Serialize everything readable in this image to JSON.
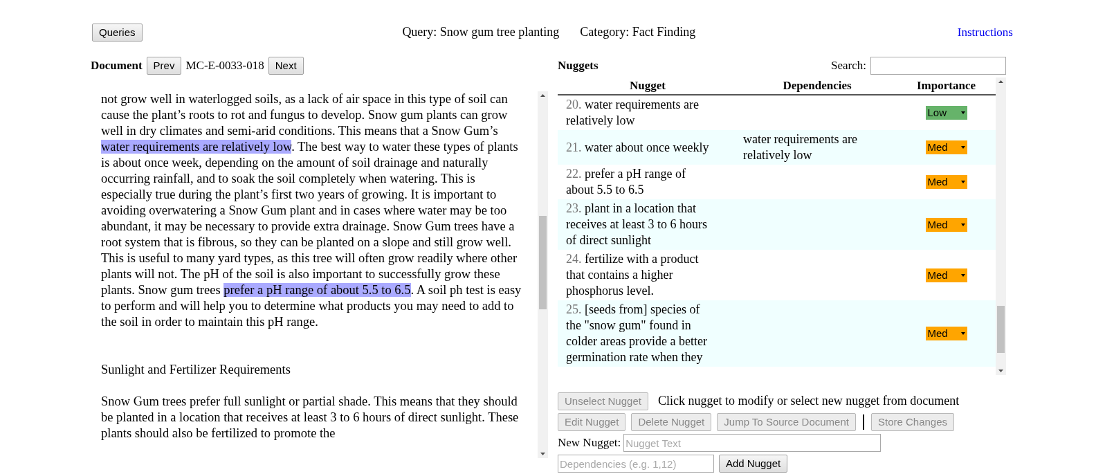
{
  "header": {
    "queries_button": {
      "label": "Queries",
      "disabled": false
    },
    "query": "Query: Snow gum tree planting",
    "category": "Category: Fact Finding",
    "instructions_link": "Instructions"
  },
  "document": {
    "label": "Document",
    "prev": {
      "label": "Prev",
      "disabled": false
    },
    "id": "MC-E-0033-018",
    "next": {
      "label": "Next",
      "disabled": false
    },
    "paragraphs": [
      {
        "kind": "text",
        "segments": [
          {
            "text": "not grow well in waterlogged soils, as a lack of air space in this type of soil can cause the plant’s roots to rot and fungus to develop. Snow gum plants can grow well in dry climates and semi-arid conditions. This means that a Snow Gum’s ",
            "highlighted": false
          },
          {
            "text": "water requirements are relatively low",
            "highlighted": true
          },
          {
            "text": ". The best way to water these types of plants is about once week, depending on the amount of soil drainage and naturally occurring rainfall, and to soak the soil completely when watering. This is especially true during the plant’s first two years of growing. It is important to avoiding overwatering a Snow Gum plant and in cases where water may be too abundant, it may be necessary to provide extra drainage. Snow Gum trees have a root system that is fibrous, so they can be planted on a slope and still grow well. This is useful to many yard types, as this tree will often grow readily where other plants will not. The pH of the soil is also important to successfully grow these plants. Snow gum trees ",
            "highlighted": false
          },
          {
            "text": "prefer a pH range of about 5.5 to 6.5",
            "highlighted": true
          },
          {
            "text": ". A soil ph test is easy to perform and will help you to determine what products you may need to add to the soil in order to maintain this pH range.",
            "highlighted": false
          }
        ]
      },
      {
        "kind": "heading",
        "segments": [
          {
            "text": "Sunlight and Fertilizer Requirements",
            "highlighted": false
          }
        ]
      },
      {
        "kind": "text",
        "segments": [
          {
            "text": "Snow Gum trees prefer full sunlight or partial shade. This means that they should be planted in a location that receives at least 3 to 6 hours of direct sunlight. These plants should also be fertilized to promote the",
            "highlighted": false
          }
        ]
      }
    ]
  },
  "nuggets": {
    "label": "Nuggets",
    "search_label": "Search:",
    "columns": [
      "Nugget",
      "Dependencies",
      "Importance"
    ],
    "rows": [
      {
        "number": "20.",
        "text": "water requirements are relatively low",
        "importance": {
          "label": "Low",
          "color": "#66b36a"
        }
      },
      {
        "number": "21.",
        "text": "water about once weekly",
        "dependencies": "water requirements are relatively low",
        "importance": {
          "label": "Med",
          "color": "#ffa500"
        }
      },
      {
        "number": "22.",
        "text": "prefer a pH range of about 5.5 to 6.5",
        "importance": {
          "label": "Med",
          "color": "#ffa500"
        }
      },
      {
        "number": "23.",
        "text": "plant in a location that receives at least 3 to 6 hours of direct sunlight",
        "importance": {
          "label": "Med",
          "color": "#ffa500"
        }
      },
      {
        "number": "24.",
        "text": "fertilize with a product that contains a higher phosphorus level.",
        "importance": {
          "label": "Med",
          "color": "#ffa500"
        }
      },
      {
        "number": "25.",
        "text": "[seeds from] species of the \"snow gum\" found in colder areas provide a better germination rate when they",
        "importance": {
          "label": "Med",
          "color": "#ffa500"
        }
      }
    ]
  },
  "actions": {
    "unselect": {
      "label": "Unselect Nugget",
      "disabled": true
    },
    "hint": "Click nugget to modify or select new nugget from document",
    "row_buttons": [
      {
        "label": "Edit Nugget",
        "disabled": true
      },
      {
        "label": "Delete Nugget",
        "disabled": true
      },
      {
        "label": "Jump To Source Document",
        "disabled": true
      }
    ],
    "store": {
      "label": "Store Changes",
      "disabled": true
    },
    "new_nugget_label": "New Nugget:",
    "nugget_placeholder": "Nugget Text",
    "dependencies_placeholder": "Dependencies (e.g. 1,12)",
    "add": {
      "label": "Add Nugget",
      "disabled": false
    }
  }
}
